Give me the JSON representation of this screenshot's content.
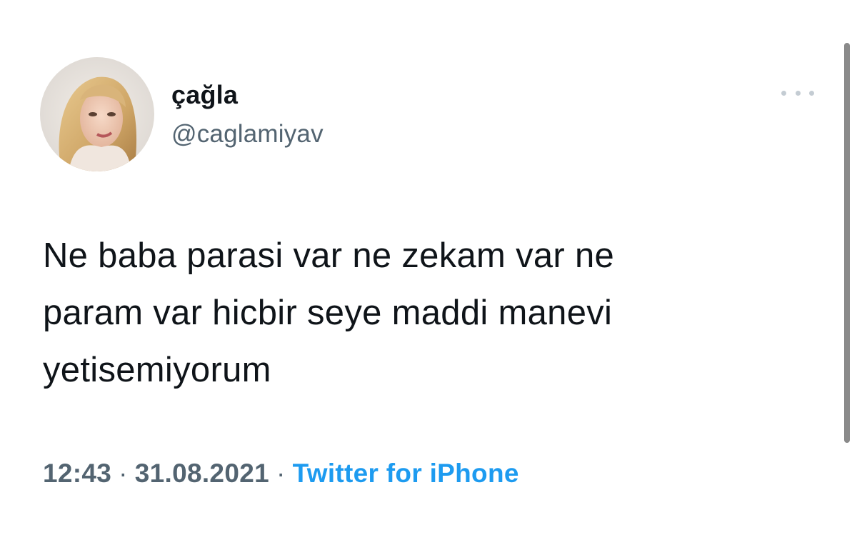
{
  "tweet": {
    "display_name": "çağla",
    "handle": "@caglamiyav",
    "text": "Ne baba parasi var ne zekam var ne\nparam var hicbir seye maddi manevi\nyetisemiyorum",
    "time": "12:43",
    "separator": "·",
    "date": "31.08.2021",
    "source": "Twitter for iPhone",
    "more_icon": "more-horizontal-icon",
    "avatar_icon": "profile-photo"
  },
  "colors": {
    "text_primary": "#0f1419",
    "text_secondary": "#536471",
    "link": "#1d9bf0",
    "background": "#ffffff",
    "more_dots": "#c4ccd3",
    "scrollbar": "#8a8a8a"
  }
}
